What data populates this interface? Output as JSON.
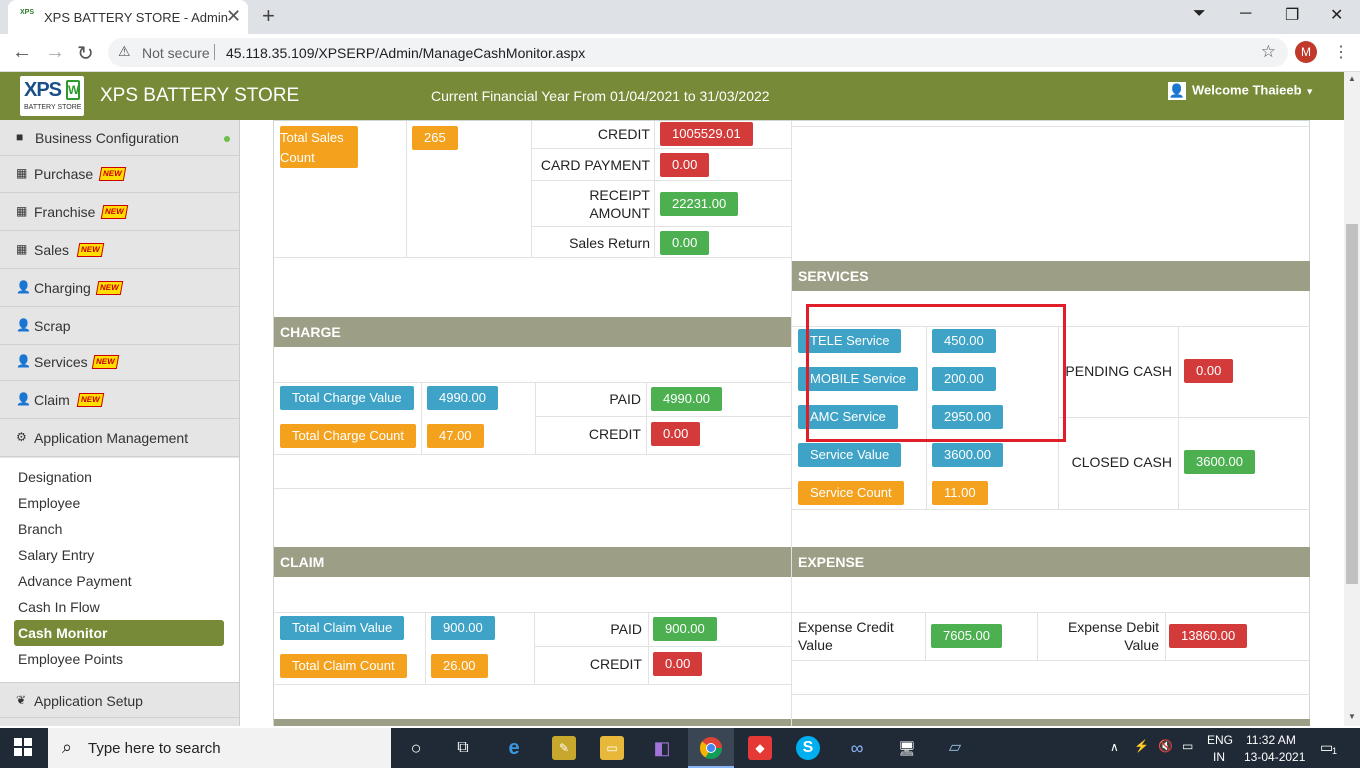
{
  "browser": {
    "tab_title": "XPS BATTERY STORE - Admin",
    "favicon_text": "XPS",
    "security_label": "Not secure",
    "url": "45.118.35.109/XPSERP/Admin/ManageCashMonitor.aspx",
    "avatar_letter": "M"
  },
  "header": {
    "logo_text": "XPS",
    "logo_sub": "BATTERY STORE",
    "app_name": "XPS BATTERY STORE",
    "financial_year": "Current Financial Year From 01/04/2021 to 31/03/2022",
    "welcome": "Welcome Thaieeb"
  },
  "sidebar": {
    "new_badge": "NEW",
    "items": [
      {
        "label": "Business Configuration",
        "icon": "briefcase-icon"
      },
      {
        "label": "Purchase",
        "icon": "grid-icon"
      },
      {
        "label": "Franchise",
        "icon": "grid-icon"
      },
      {
        "label": "Sales",
        "icon": "grid-icon"
      },
      {
        "label": "Charging",
        "icon": "user-icon"
      },
      {
        "label": "Scrap",
        "icon": "user-icon"
      },
      {
        "label": "Services",
        "icon": "user-icon"
      },
      {
        "label": "Claim",
        "icon": "user-icon"
      },
      {
        "label": "Application Management",
        "icon": "gear-icon"
      }
    ],
    "submenu": [
      "Designation",
      "Employee",
      "Branch",
      "Salary Entry",
      "Advance Payment",
      "Cash In Flow",
      "Cash Monitor",
      "Employee Points"
    ],
    "setup": "Application Setup"
  },
  "sales": {
    "total_sales_count_label": "Total Sales Count",
    "total_sales_count": "265",
    "credit_label": "CREDIT",
    "credit": "1005529.01",
    "card_label": "CARD PAYMENT",
    "card": "0.00",
    "receipt_label": "RECEIPT AMOUNT",
    "receipt": "22231.00",
    "return_label": "Sales Return",
    "return": "0.00"
  },
  "charge": {
    "title": "CHARGE",
    "total_value_label": "Total Charge Value",
    "total_value": "4990.00",
    "total_count_label": "Total Charge Count",
    "total_count": "47.00",
    "paid_label": "PAID",
    "paid": "4990.00",
    "credit_label": "CREDIT",
    "credit": "0.00"
  },
  "services": {
    "title": "SERVICES",
    "tele_label": "TELE Service",
    "tele": "450.00",
    "mobile_label": "MOBILE Service",
    "mobile": "200.00",
    "amc_label": "AMC Service",
    "amc": "2950.00",
    "value_label": "Service Value",
    "value": "3600.00",
    "count_label": "Service Count",
    "count": "11.00",
    "pending_label": "PENDING CASH",
    "pending": "0.00",
    "closed_label": "CLOSED CASH",
    "closed": "3600.00"
  },
  "claim": {
    "title": "CLAIM",
    "total_value_label": "Total Claim Value",
    "total_value": "900.00",
    "total_count_label": "Total Claim Count",
    "total_count": "26.00",
    "paid_label": "PAID",
    "paid": "900.00",
    "credit_label": "CREDIT",
    "credit": "0.00"
  },
  "expense": {
    "title": "EXPENSE",
    "credit_label": "Expense Credit Value",
    "credit": "7605.00",
    "debit_label": "Expense Debit Value",
    "debit": "13860.00"
  },
  "taskbar": {
    "search_placeholder": "Type here to search",
    "lang": "ENG",
    "region": "IN",
    "time": "11:32 AM",
    "date": "13-04-2021",
    "notifications": "1"
  }
}
